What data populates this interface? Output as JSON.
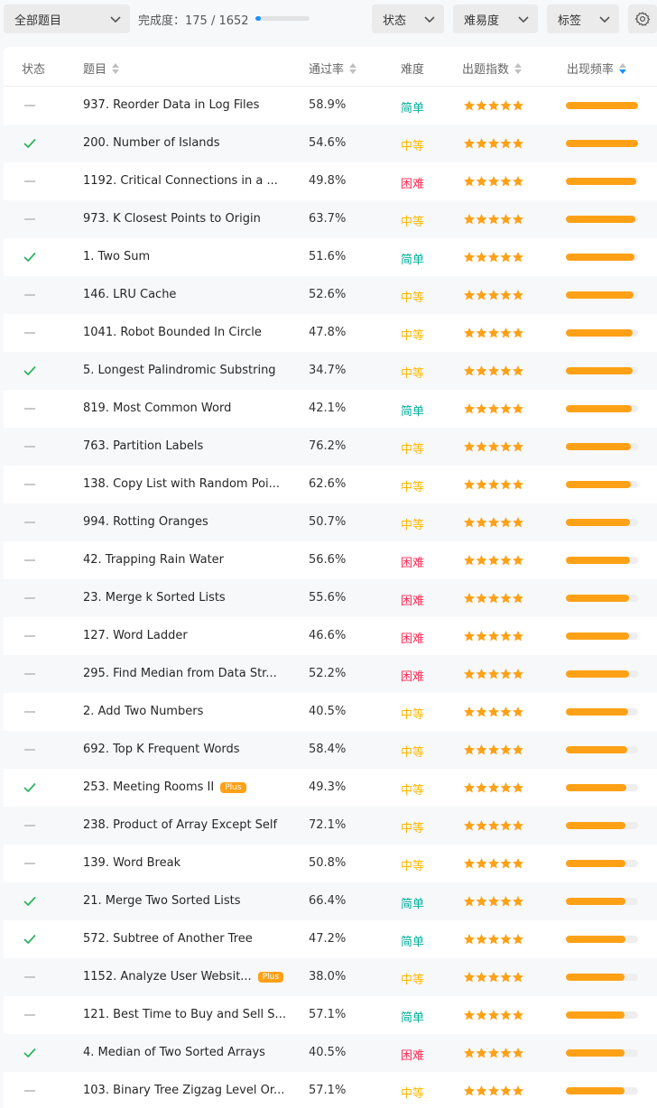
{
  "toolbar": {
    "all_questions": "全部题目",
    "progress_label": "完成度：",
    "progress_text": "175 / 1652",
    "progress_fraction": 0.106,
    "status_filter": "状态",
    "difficulty_filter": "难易度",
    "tags_filter": "标签"
  },
  "table": {
    "headers": {
      "status": "状态",
      "title": "题目",
      "acceptance": "通过率",
      "difficulty": "难度",
      "rating": "出题指数",
      "frequency": "出现频率"
    },
    "rows": [
      {
        "solved": false,
        "title": "937. Reorder Data in Log Files",
        "plus": "",
        "rate": "58.9%",
        "difficulty": "简单",
        "level": "easy",
        "stars": 5,
        "freq": 1.0
      },
      {
        "solved": true,
        "title": "200. Number of Islands",
        "plus": "",
        "rate": "54.6%",
        "difficulty": "中等",
        "level": "medium",
        "stars": 5,
        "freq": 1.0
      },
      {
        "solved": false,
        "title": "1192. Critical Connections in a ...",
        "plus": "",
        "rate": "49.8%",
        "difficulty": "困难",
        "level": "hard",
        "stars": 5,
        "freq": 0.97
      },
      {
        "solved": false,
        "title": "973. K Closest Points to Origin",
        "plus": "",
        "rate": "63.7%",
        "difficulty": "中等",
        "level": "medium",
        "stars": 5,
        "freq": 0.96
      },
      {
        "solved": true,
        "title": "1. Two Sum",
        "plus": "",
        "rate": "51.6%",
        "difficulty": "简单",
        "level": "easy",
        "stars": 5,
        "freq": 0.95
      },
      {
        "solved": false,
        "title": "146. LRU Cache",
        "plus": "",
        "rate": "52.6%",
        "difficulty": "中等",
        "level": "medium",
        "stars": 5,
        "freq": 0.94
      },
      {
        "solved": false,
        "title": "1041. Robot Bounded In Circle",
        "plus": "",
        "rate": "47.8%",
        "difficulty": "中等",
        "level": "medium",
        "stars": 5,
        "freq": 0.92
      },
      {
        "solved": true,
        "title": "5. Longest Palindromic Substring",
        "plus": "",
        "rate": "34.7%",
        "difficulty": "中等",
        "level": "medium",
        "stars": 5,
        "freq": 0.92
      },
      {
        "solved": false,
        "title": "819. Most Common Word",
        "plus": "",
        "rate": "42.1%",
        "difficulty": "简单",
        "level": "easy",
        "stars": 5,
        "freq": 0.91
      },
      {
        "solved": false,
        "title": "763. Partition Labels",
        "plus": "",
        "rate": "76.2%",
        "difficulty": "中等",
        "level": "medium",
        "stars": 5,
        "freq": 0.9
      },
      {
        "solved": false,
        "title": "138. Copy List with Random Poi...",
        "plus": "",
        "rate": "62.6%",
        "difficulty": "中等",
        "level": "medium",
        "stars": 5,
        "freq": 0.9
      },
      {
        "solved": false,
        "title": "994. Rotting Oranges",
        "plus": "",
        "rate": "50.7%",
        "difficulty": "中等",
        "level": "medium",
        "stars": 5,
        "freq": 0.89
      },
      {
        "solved": false,
        "title": "42. Trapping Rain Water",
        "plus": "",
        "rate": "56.6%",
        "difficulty": "困难",
        "level": "hard",
        "stars": 5,
        "freq": 0.89
      },
      {
        "solved": false,
        "title": "23. Merge k Sorted Lists",
        "plus": "",
        "rate": "55.6%",
        "difficulty": "困难",
        "level": "hard",
        "stars": 5,
        "freq": 0.88
      },
      {
        "solved": false,
        "title": "127. Word Ladder",
        "plus": "",
        "rate": "46.6%",
        "difficulty": "困难",
        "level": "hard",
        "stars": 5,
        "freq": 0.88
      },
      {
        "solved": false,
        "title": "295. Find Median from Data Str...",
        "plus": "",
        "rate": "52.2%",
        "difficulty": "困难",
        "level": "hard",
        "stars": 5,
        "freq": 0.87
      },
      {
        "solved": false,
        "title": "2. Add Two Numbers",
        "plus": "",
        "rate": "40.5%",
        "difficulty": "中等",
        "level": "medium",
        "stars": 5,
        "freq": 0.86
      },
      {
        "solved": false,
        "title": "692. Top K Frequent Words",
        "plus": "",
        "rate": "58.4%",
        "difficulty": "中等",
        "level": "medium",
        "stars": 5,
        "freq": 0.85
      },
      {
        "solved": true,
        "title": "253. Meeting Rooms II",
        "plus": "Plus",
        "rate": "49.3%",
        "difficulty": "中等",
        "level": "medium",
        "stars": 5,
        "freq": 0.84
      },
      {
        "solved": false,
        "title": "238. Product of Array Except Self",
        "plus": "",
        "rate": "72.1%",
        "difficulty": "中等",
        "level": "medium",
        "stars": 5,
        "freq": 0.83
      },
      {
        "solved": false,
        "title": "139. Word Break",
        "plus": "",
        "rate": "50.8%",
        "difficulty": "中等",
        "level": "medium",
        "stars": 5,
        "freq": 0.83
      },
      {
        "solved": true,
        "title": "21. Merge Two Sorted Lists",
        "plus": "",
        "rate": "66.4%",
        "difficulty": "简单",
        "level": "easy",
        "stars": 5,
        "freq": 0.83
      },
      {
        "solved": true,
        "title": "572. Subtree of Another Tree",
        "plus": "",
        "rate": "47.2%",
        "difficulty": "简单",
        "level": "easy",
        "stars": 5,
        "freq": 0.82
      },
      {
        "solved": false,
        "title": "1152. Analyze User Websit...",
        "plus": "Plus",
        "rate": "38.0%",
        "difficulty": "中等",
        "level": "medium",
        "stars": 5,
        "freq": 0.81
      },
      {
        "solved": false,
        "title": "121. Best Time to Buy and Sell S...",
        "plus": "",
        "rate": "57.1%",
        "difficulty": "简单",
        "level": "easy",
        "stars": 5,
        "freq": 0.81
      },
      {
        "solved": true,
        "title": "4. Median of Two Sorted Arrays",
        "plus": "",
        "rate": "40.5%",
        "difficulty": "困难",
        "level": "hard",
        "stars": 5,
        "freq": 0.81
      },
      {
        "solved": false,
        "title": "103. Binary Tree Zigzag Level Or...",
        "plus": "",
        "rate": "57.1%",
        "difficulty": "中等",
        "level": "medium",
        "stars": 5,
        "freq": 0.81
      }
    ]
  },
  "colors": {
    "easy": "#00af9b",
    "medium": "#ffb800",
    "hard": "#ff2d55",
    "accent": "#1a90ff",
    "star": "#ffa116",
    "check": "#2db55d"
  }
}
